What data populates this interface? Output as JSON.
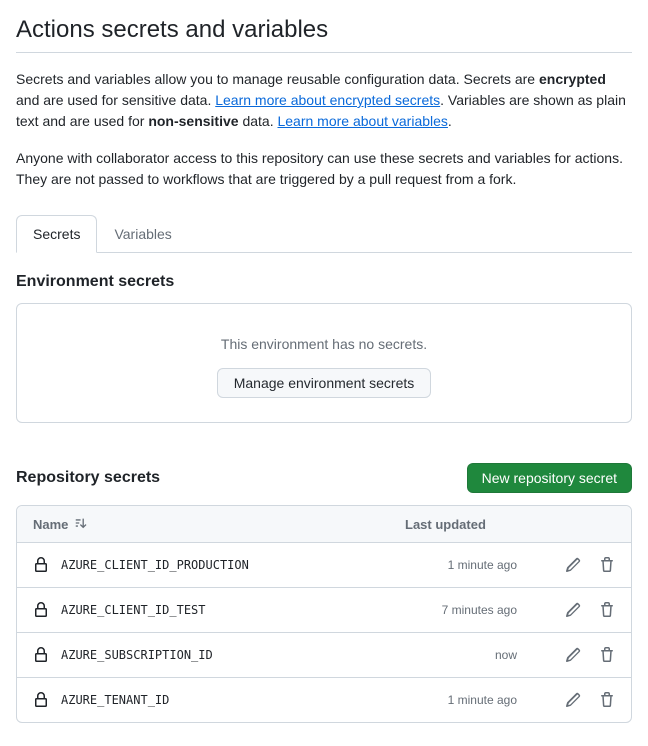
{
  "page": {
    "title": "Actions secrets and variables",
    "intro1_a": "Secrets and variables allow you to manage reusable configuration data. Secrets are ",
    "intro1_bold1": "encrypted",
    "intro1_b": " and are used for sensitive data. ",
    "link_secrets": "Learn more about encrypted secrets",
    "intro1_c": ". Variables are shown as plain text and are used for ",
    "intro1_bold2": "non-sensitive",
    "intro1_d": " data. ",
    "link_variables": "Learn more about variables",
    "intro1_e": ".",
    "intro2": "Anyone with collaborator access to this repository can use these secrets and variables for actions. They are not passed to workflows that are triggered by a pull request from a fork."
  },
  "tabs": {
    "secrets": "Secrets",
    "variables": "Variables"
  },
  "env": {
    "heading": "Environment secrets",
    "empty_text": "This environment has no secrets.",
    "manage_button": "Manage environment secrets"
  },
  "repo": {
    "heading": "Repository secrets",
    "new_button": "New repository secret",
    "col_name": "Name",
    "col_updated": "Last updated",
    "rows": [
      {
        "name": "AZURE_CLIENT_ID_PRODUCTION",
        "updated": "1 minute ago"
      },
      {
        "name": "AZURE_CLIENT_ID_TEST",
        "updated": "7 minutes ago"
      },
      {
        "name": "AZURE_SUBSCRIPTION_ID",
        "updated": "now"
      },
      {
        "name": "AZURE_TENANT_ID",
        "updated": "1 minute ago"
      }
    ]
  }
}
